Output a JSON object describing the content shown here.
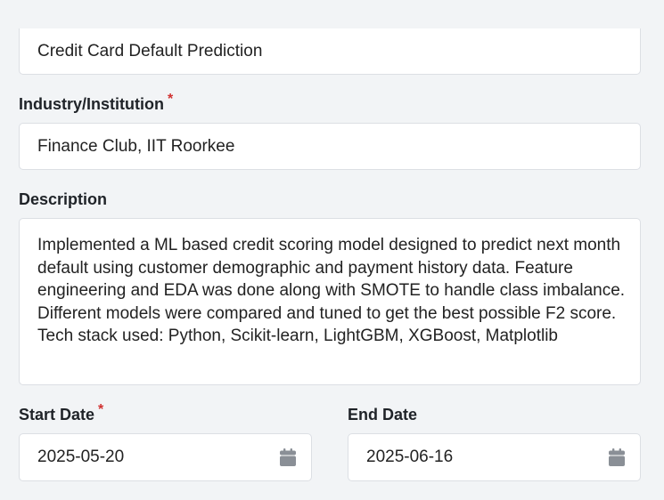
{
  "form": {
    "title_value": "Credit Card Default Prediction",
    "institution": {
      "label": "Industry/Institution",
      "required_mark": "*",
      "value": "Finance Club, IIT Roorkee"
    },
    "description": {
      "label": "Description",
      "value": "Implemented a ML based credit scoring model designed to predict next month default using customer demographic and payment history data. Feature engineering and EDA was done along with SMOTE to handle class imbalance. Different models were compared and tuned to get the best possible F2 score.\nTech stack used: Python, Scikit-learn, LightGBM, XGBoost, Matplotlib"
    },
    "start_date": {
      "label": "Start Date",
      "required_mark": "*",
      "value": "2025-05-20",
      "icon": "calendar-icon"
    },
    "end_date": {
      "label": "End Date",
      "value": "2025-06-16",
      "icon": "calendar-icon"
    }
  },
  "colors": {
    "page_background": "#f2f4f6",
    "field_background": "#ffffff",
    "field_border": "#dcdfe4",
    "required_mark": "#d0302f",
    "icon": "#8a8f96"
  }
}
